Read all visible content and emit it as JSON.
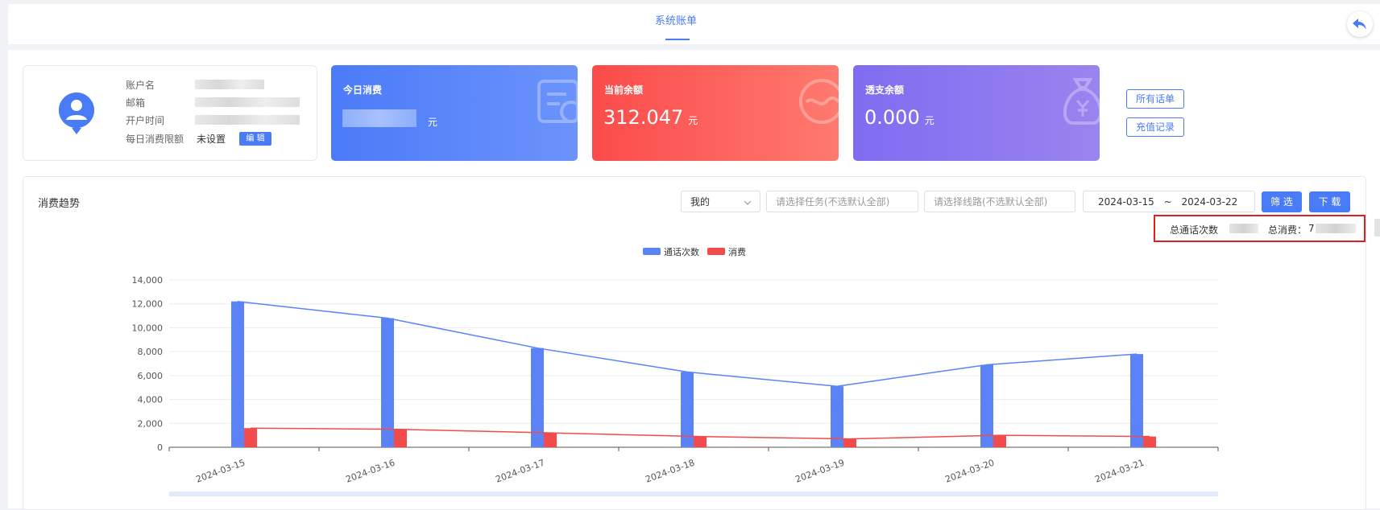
{
  "header": {
    "tab_label": "系统账单",
    "back_icon": "back-arrow-icon"
  },
  "account": {
    "labels": [
      "账户名",
      "邮箱",
      "开户时间",
      "每日消费限额"
    ],
    "daily_limit_value": "未设置",
    "edit_label": "编 辑",
    "avatar_icon": "user-avatar-icon"
  },
  "cards": {
    "today": {
      "title": "今日消费",
      "value": "",
      "unit": "元",
      "color": "#4b7bf8",
      "icon": "bill-icon"
    },
    "balance": {
      "title": "当前余额",
      "value": "312.047",
      "unit": "元",
      "color": "#fb4b4b",
      "icon": "wallet-icon"
    },
    "overdraft": {
      "title": "透支余额",
      "value": "0.000",
      "unit": "元",
      "color": "#7f6cf0",
      "icon": "money-bag-icon"
    }
  },
  "side_buttons": {
    "all_calls": "所有话单",
    "recharge": "充值记录"
  },
  "filters": {
    "title": "消费趋势",
    "scope_value": "我的",
    "task_placeholder": "请选择任务(不选默认全部)",
    "line_placeholder": "请选择线路(不选默认全部)",
    "date_start": "2024-03-15",
    "date_sep": "~",
    "date_end": "2024-03-22",
    "filter_btn": "筛 选",
    "download_btn": "下 载"
  },
  "totals": {
    "calls_label": "总通话次数",
    "cost_label": "总消费：",
    "cost_prefix": "7"
  },
  "chart_data": {
    "type": "bar",
    "categories": [
      "2024-03-15",
      "2024-03-16",
      "2024-03-17",
      "2024-03-18",
      "2024-03-19",
      "2024-03-20",
      "2024-03-21"
    ],
    "series": [
      {
        "name": "通话次数",
        "color": "#5b83f7",
        "values": [
          12200,
          10800,
          8300,
          6300,
          5100,
          6900,
          7800
        ]
      },
      {
        "name": "消费",
        "color": "#f24b4b",
        "values": [
          1600,
          1500,
          1200,
          900,
          700,
          1000,
          900
        ]
      }
    ],
    "ylim": [
      0,
      14000
    ],
    "yticks": [
      "0",
      "2,000",
      "4,000",
      "6,000",
      "8,000",
      "10,000",
      "12,000",
      "14,000"
    ],
    "legend": "top-center",
    "grid": true
  }
}
